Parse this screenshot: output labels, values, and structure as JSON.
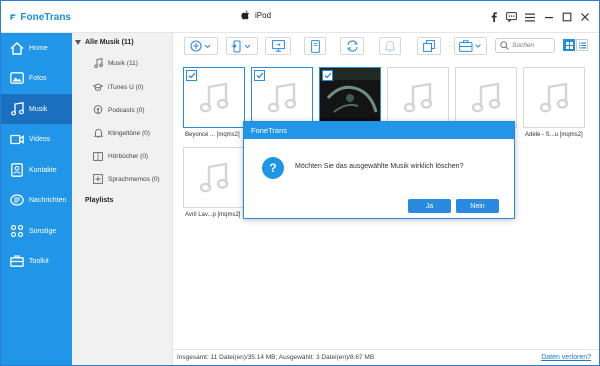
{
  "app": {
    "name": "FoneTrans",
    "device": "iPod"
  },
  "sidebar": {
    "items": [
      {
        "label": "Home",
        "icon": "home-icon"
      },
      {
        "label": "Fotos",
        "icon": "photos-icon"
      },
      {
        "label": "Musik",
        "icon": "music-icon",
        "active": true
      },
      {
        "label": "Videos",
        "icon": "video-icon"
      },
      {
        "label": "Kontakte",
        "icon": "contacts-icon"
      },
      {
        "label": "Nachrichten",
        "icon": "messages-icon"
      },
      {
        "label": "Sonstige",
        "icon": "other-icon"
      },
      {
        "label": "Toolkit",
        "icon": "toolkit-icon"
      }
    ]
  },
  "subpanel": {
    "heading": "Alle Musik (11)",
    "items": [
      {
        "label": "Musik (11)",
        "icon": "music-note-icon"
      },
      {
        "label": "iTunes U (0)",
        "icon": "itunes-u-icon"
      },
      {
        "label": "Podcasts (0)",
        "icon": "podcast-icon"
      },
      {
        "label": "Klingeltöne (0)",
        "icon": "bell-icon"
      },
      {
        "label": "Hörbücher (0)",
        "icon": "audiobook-icon"
      },
      {
        "label": "Sprachmemos (0)",
        "icon": "voice-memo-icon"
      }
    ],
    "playlists_label": "Playlists"
  },
  "toolbar": {
    "search_placeholder": "Suchen"
  },
  "grid": {
    "tiles": [
      {
        "label": "Beyoncé ... [mqms2]",
        "checked": true
      },
      {
        "label": "",
        "checked": true
      },
      {
        "label": "",
        "checked": true,
        "photo": true
      },
      {
        "label": "",
        "checked": false
      },
      {
        "label": "",
        "checked": false
      },
      {
        "label": "Adele - S...u [mqms2]",
        "checked": false
      },
      {
        "label": "Avril Lav...p [mqms2]",
        "checked": false
      }
    ]
  },
  "status": {
    "summary": "Insgesamt: 11 Datei(en)/35.14 MB; Ausgewählt: 3 Datei(en)/8.67 MB",
    "link": "Daten verloren?"
  },
  "dialog": {
    "title": "FoneTrans",
    "message": "Möchten Sie das ausgewählte Musik wirklich löschen?",
    "yes": "Ja",
    "no": "Nein"
  },
  "colors": {
    "accent": "#2196e8",
    "sidebar_active": "#1a6fbf",
    "panel": "#f1f1f1"
  }
}
